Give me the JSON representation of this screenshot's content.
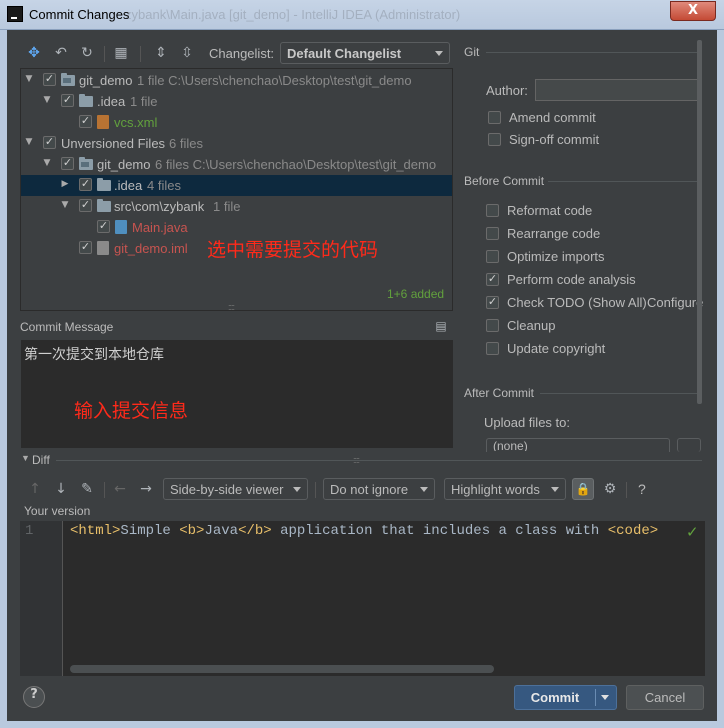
{
  "window": {
    "title": "Commit Changes",
    "ghost_title": "zybank\\Main.java [git_demo] - IntelliJ IDEA (Administrator)",
    "close_glyph": "X",
    "app_icon_glyph": "IJ"
  },
  "toolbar": {
    "changelist_label": "Changelist:",
    "changelist_value": "Default Changelist",
    "icons": [
      "diff-icon",
      "rollback-icon",
      "refresh-icon",
      "group-by-icon",
      "expand-all-icon",
      "collapse-all-icon"
    ]
  },
  "tree": {
    "rows": [
      {
        "label": "git_demo",
        "extra": "1 file  C:\\Users\\chenchao\\Desktop\\test\\git_demo",
        "kind": "module"
      },
      {
        "label": ".idea",
        "extra": "1 file",
        "kind": "folder"
      },
      {
        "label": "vcs.xml",
        "extra": "",
        "kind": "file-xml"
      },
      {
        "label": "Unversioned Files",
        "extra": "6 files",
        "kind": "group"
      },
      {
        "label": "git_demo",
        "extra": "6 files  C:\\Users\\chenchao\\Desktop\\test\\git_demo",
        "kind": "module"
      },
      {
        "label": ".idea",
        "extra": "4 files",
        "kind": "folder"
      },
      {
        "label": "src\\com\\zybank",
        "extra": "1 file",
        "kind": "folder"
      },
      {
        "label": "Main.java",
        "extra": "",
        "kind": "file-java"
      },
      {
        "label": "git_demo.iml",
        "extra": "",
        "kind": "file-iml"
      }
    ],
    "summary": "1+6 added",
    "annotation": "选中需要提交的代码"
  },
  "git": {
    "section_title": "Git",
    "author_label": "Author:",
    "author_value": "",
    "amend_label": "Amend commit",
    "signoff_label": "Sign-off commit"
  },
  "before_commit": {
    "title": "Before Commit",
    "options": [
      {
        "label": "Reformat code",
        "checked": false
      },
      {
        "label": "Rearrange code",
        "checked": false
      },
      {
        "label": "Optimize imports",
        "checked": false
      },
      {
        "label": "Perform code analysis",
        "checked": true
      },
      {
        "label": "Check TODO (Show All)",
        "checked": true,
        "link": "Configure"
      },
      {
        "label": "Cleanup",
        "checked": false
      },
      {
        "label": "Update copyright",
        "checked": false
      }
    ]
  },
  "after_commit": {
    "title": "After Commit",
    "upload_label": "Upload files to:",
    "upload_value": "(none)"
  },
  "message": {
    "label": "Commit Message",
    "text": "第一次提交到本地仓库",
    "annotation": "输入提交信息"
  },
  "diff": {
    "label": "Diff",
    "viewer": "Side-by-side viewer",
    "ignore": "Do not ignore",
    "highlight": "Highlight words",
    "help_glyph": "?",
    "version_label": "Your version",
    "line_number": "1",
    "code": {
      "t1": "<html>",
      "t2": "Simple ",
      "t3": "<b>",
      "t4": "Java",
      "t5": "</b>",
      "t6": " application that includes a class with ",
      "t7": "<code>"
    }
  },
  "footer": {
    "help_glyph": "?",
    "commit_label": "Commit",
    "cancel_label": "Cancel"
  },
  "colors": {
    "background": "#3c3f41",
    "editor_bg": "#2b2b2b",
    "selection": "#0d293e",
    "added_green": "#62a13d",
    "unversioned_red": "#c75450",
    "annotation_red": "#ff2a1a",
    "link_blue": "#589df6",
    "primary_button": "#365880"
  }
}
